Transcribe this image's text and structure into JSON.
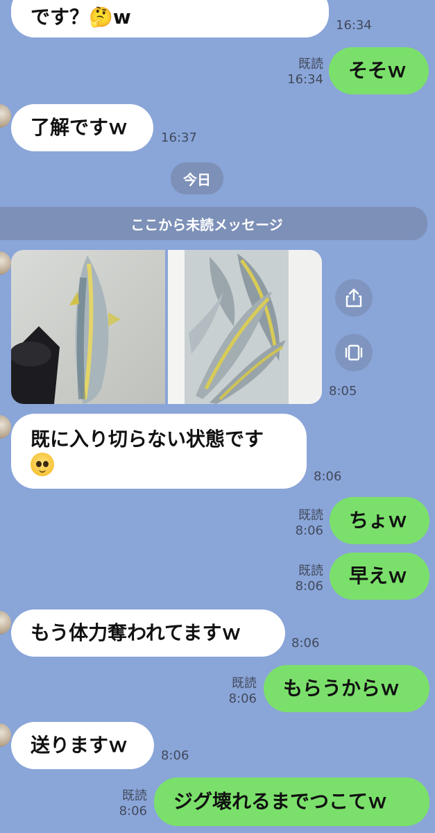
{
  "messages": {
    "m1": {
      "text": "です？🤔w",
      "time": "16:34"
    },
    "m2": {
      "text": "そそｗ",
      "read": "既読",
      "time": "16:34"
    },
    "m3": {
      "text": "了解ですｗ",
      "time": "16:37"
    },
    "m5": {
      "time": "8:05"
    },
    "m6": {
      "text": "既に入り切らない状態です",
      "emoji": "pleading-face",
      "time": "8:06"
    },
    "m7": {
      "text": "ちょｗ",
      "read": "既読",
      "time": "8:06"
    },
    "m8": {
      "text": "早えｗ",
      "read": "既読",
      "time": "8:06"
    },
    "m9": {
      "text": "もう体力奪われてますｗ",
      "time": "8:06"
    },
    "m10": {
      "text": "もらうからｗ",
      "read": "既読",
      "time": "8:06"
    },
    "m11": {
      "text": "送りますｗ",
      "time": "8:06"
    },
    "m12": {
      "text": "ジグ壊れるまでつこてｗ",
      "read": "既読",
      "time": "8:06"
    }
  },
  "date_divider": "今日",
  "unread_divider": "ここから未読メッセージ",
  "icons": {
    "share": "share-icon",
    "gallery": "gallery-icon"
  },
  "colors": {
    "background": "#8aa5d8",
    "outgoing": "#7be06b",
    "incoming": "#ffffff"
  }
}
